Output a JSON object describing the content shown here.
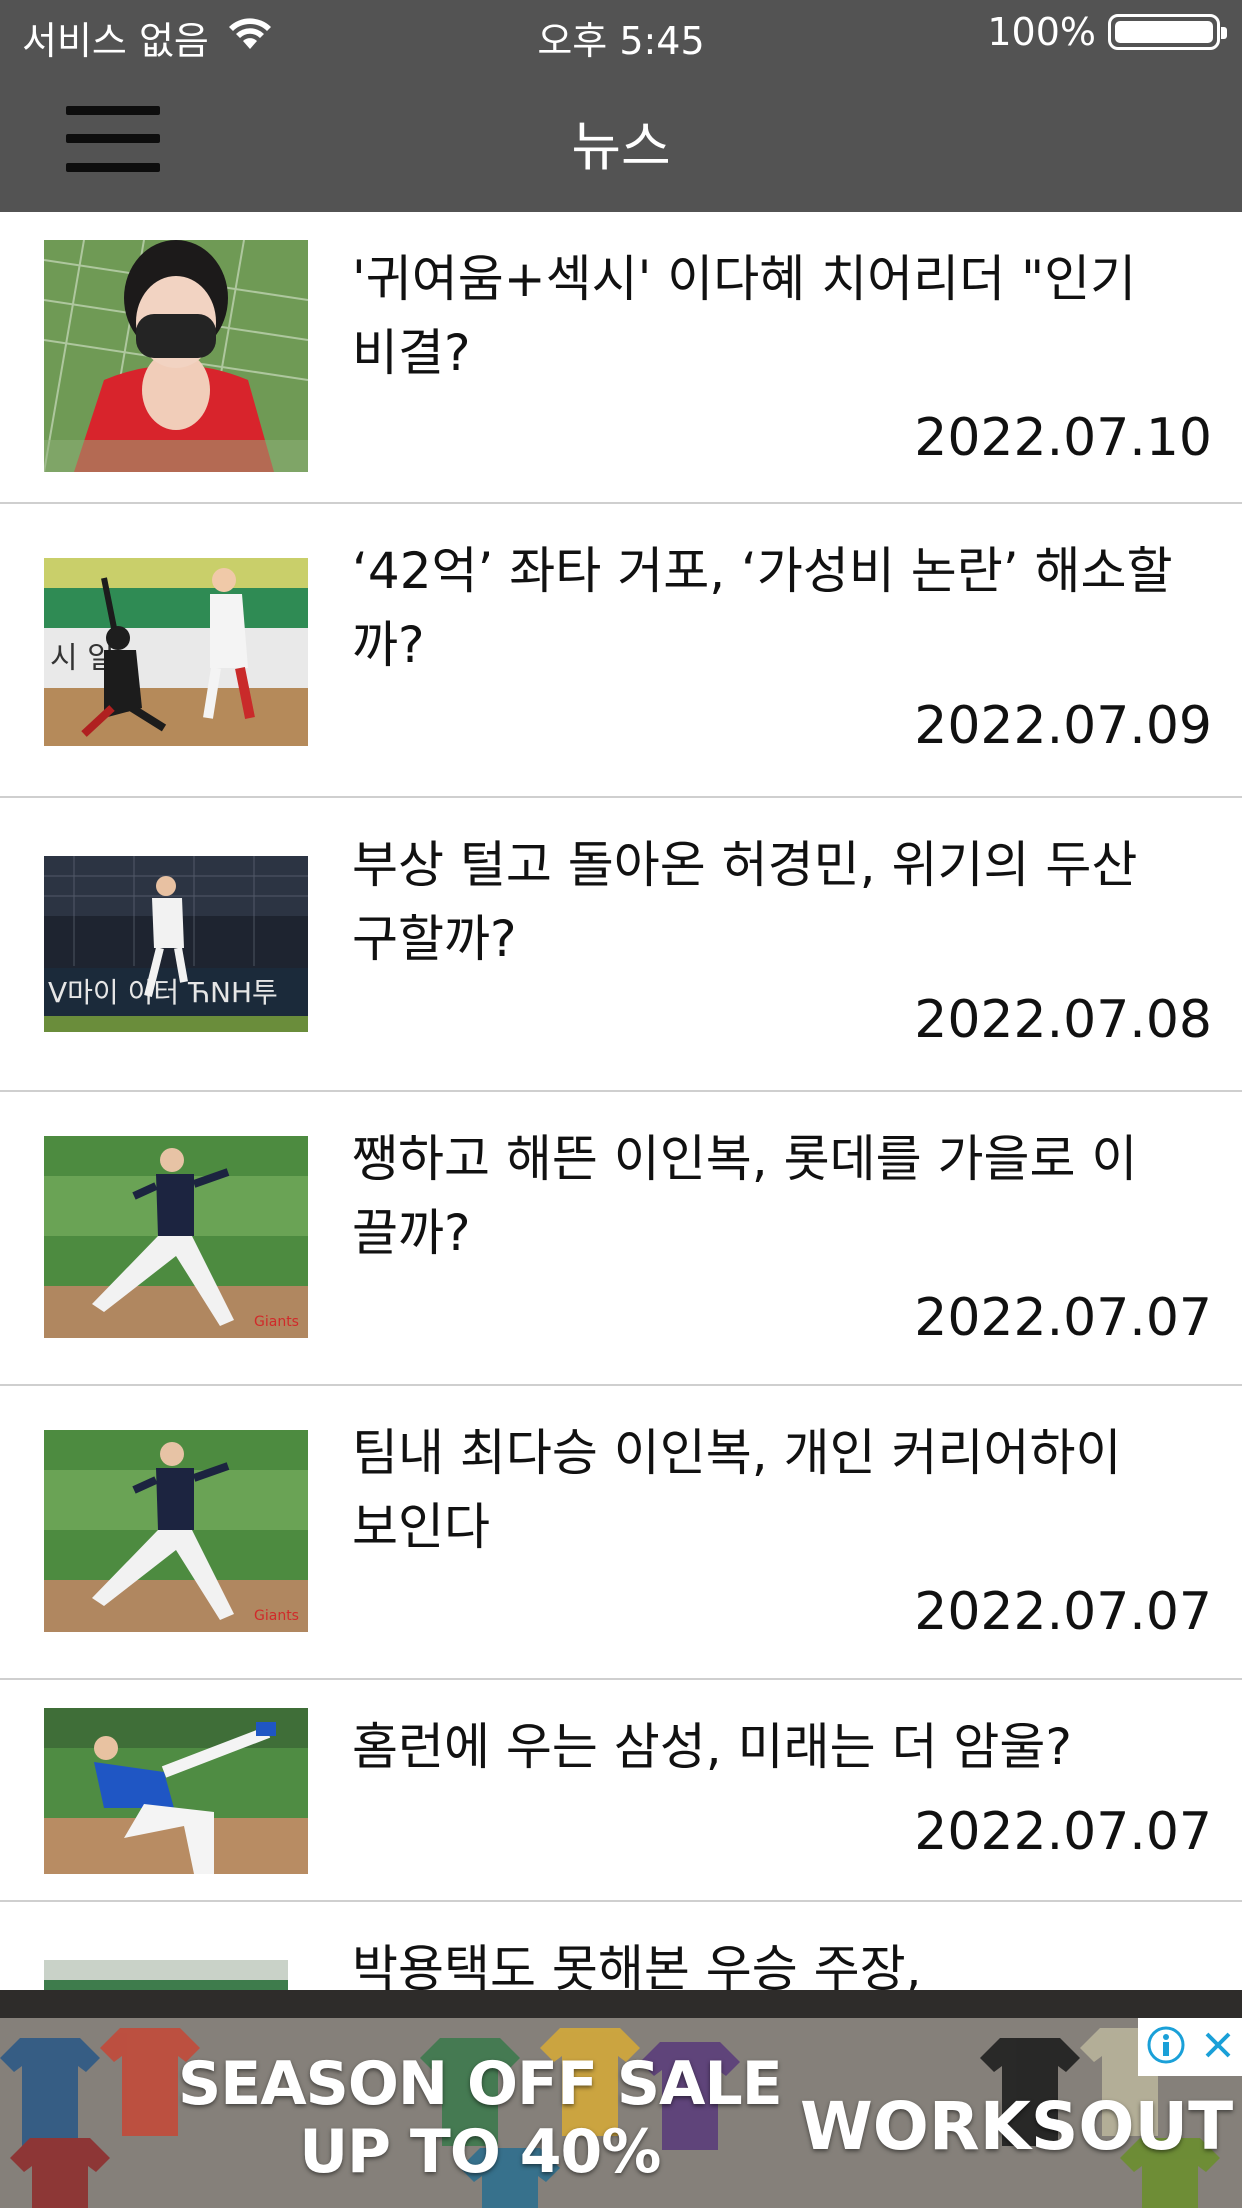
{
  "status_bar": {
    "carrier": "서비스 없음",
    "time": "오후 5:45",
    "battery": "100%",
    "battery_level": 1.0
  },
  "nav": {
    "title": "뉴스",
    "menu_icon": "hamburger-menu-icon"
  },
  "news": [
    {
      "title": "'귀여움+섹시' 이다혜 치어리더 \"인기 비결?",
      "date": "2022.07.10"
    },
    {
      "title": "‘42억’ 좌타 거포, ‘가성비 논란’ 해소할까?",
      "date": "2022.07.09"
    },
    {
      "title": "부상 털고 돌아온 허경민, 위기의 두산 구할까?",
      "date": "2022.07.08"
    },
    {
      "title": "쨍하고 해뜬 이인복, 롯데를 가을로 이끌까?",
      "date": "2022.07.07"
    },
    {
      "title": "팀내 최다승 이인복, 개인 커리어하이 보인다",
      "date": "2022.07.07"
    },
    {
      "title": "홈런에 우는 삼성, 미래는 더 암울?",
      "date": "2022.07.07"
    },
    {
      "title": "박용택도 못해본 우승 주장,",
      "date": ""
    }
  ],
  "ad": {
    "left_line1": "SEASON OFF SALE",
    "left_line2": "UP TO 40%",
    "brand": "WORKSOUT",
    "info_icon": "info-icon",
    "close_icon": "close-icon"
  }
}
